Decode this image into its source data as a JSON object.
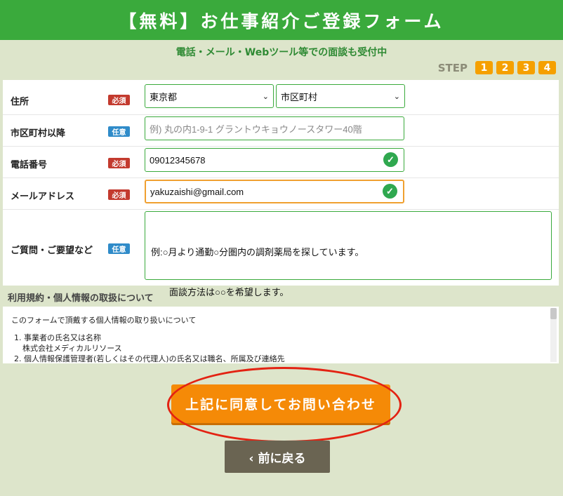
{
  "header": {
    "title": "【無料】お仕事紹介ご登録フォーム"
  },
  "subtitle": "電話・メール・Webツール等での面談も受付中",
  "steps": {
    "label": "STEP",
    "items": [
      "1",
      "2",
      "3",
      "4"
    ]
  },
  "form": {
    "address": {
      "label": "住所",
      "badge": "必須",
      "prefecture": "東京都",
      "city": "市区町村"
    },
    "address2": {
      "label": "市区町村以降",
      "badge": "任意",
      "placeholder": "例) 丸の内1-9-1 グラントウキョウノースタワー40階"
    },
    "phone": {
      "label": "電話番号",
      "badge": "必須",
      "value": "09012345678"
    },
    "email": {
      "label": "メールアドレス",
      "badge": "必須",
      "value": "yakuzaishi@gmail.com"
    },
    "notes": {
      "label": "ご質問・ご要望など",
      "badge": "任意",
      "line1": "例:○月より通勤○分圏内の調剤薬局を探しています。",
      "line2": "面談方法は○○を希望します。"
    }
  },
  "terms": {
    "title": "利用規約・個人情報の取扱について",
    "intro": "このフォームで頂戴する個人情報の取り扱いについて",
    "item1_title": "1. 事業者の氏名又は名称",
    "item1_body": "株式会社メディカルリソース",
    "item2_title": "2. 個人情報保護管理者(若しくはその代理人)の氏名又は職名、所属及び連絡先"
  },
  "buttons": {
    "agree": "上記に同意してお問い合わせ",
    "back": "‹ 前に戻る"
  }
}
